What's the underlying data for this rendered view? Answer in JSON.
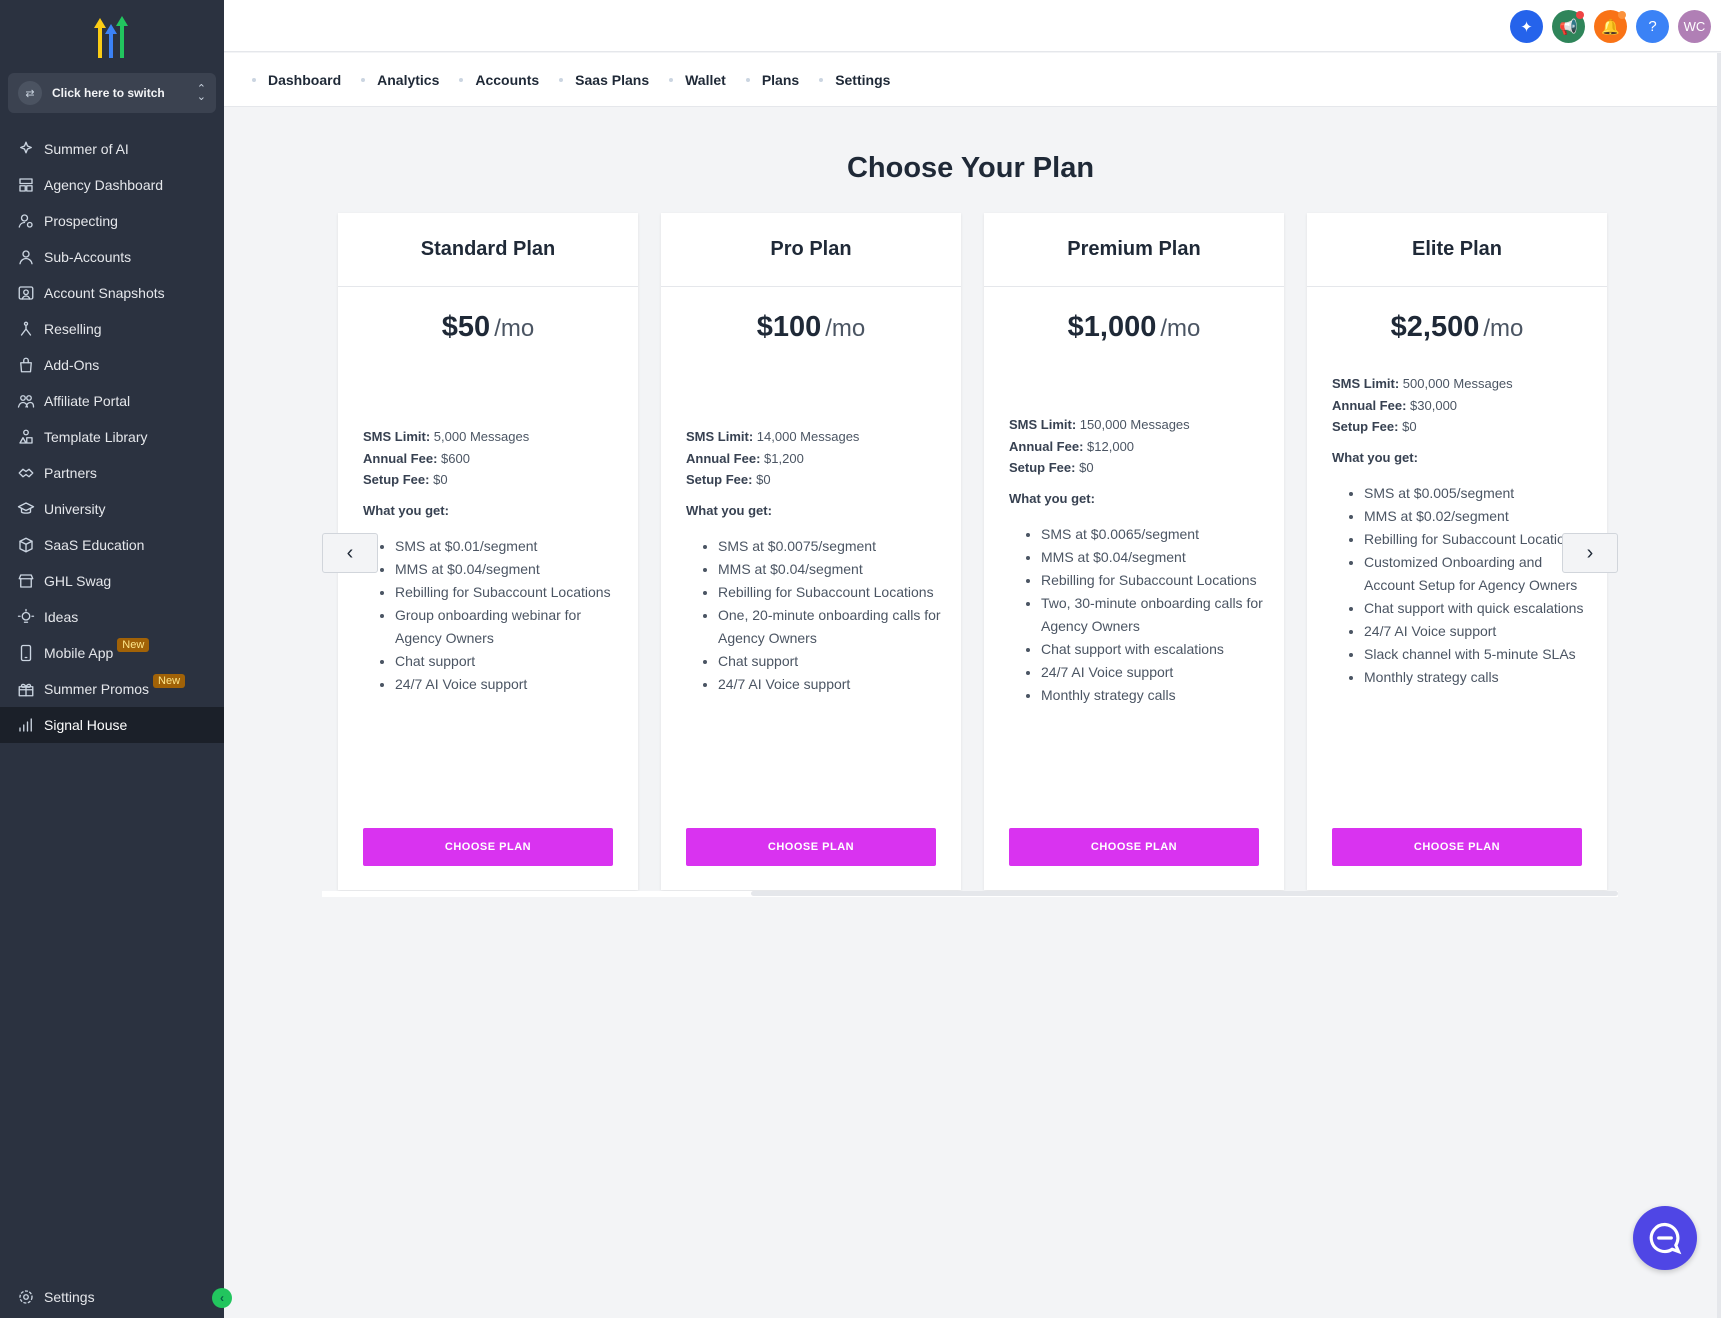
{
  "sidebar": {
    "switcher_label": "Click here to switch",
    "items": [
      {
        "label": "Summer of AI",
        "icon": "sparkle-icon"
      },
      {
        "label": "Agency Dashboard",
        "icon": "dashboard-icon"
      },
      {
        "label": "Prospecting",
        "icon": "prospecting-icon"
      },
      {
        "label": "Sub-Accounts",
        "icon": "user-icon"
      },
      {
        "label": "Account Snapshots",
        "icon": "snapshot-icon"
      },
      {
        "label": "Reselling",
        "icon": "reselling-icon"
      },
      {
        "label": "Add-Ons",
        "icon": "bag-icon"
      },
      {
        "label": "Affiliate Portal",
        "icon": "users-icon"
      },
      {
        "label": "Template Library",
        "icon": "shapes-icon"
      },
      {
        "label": "Partners",
        "icon": "handshake-icon"
      },
      {
        "label": "University",
        "icon": "graduation-cap-icon"
      },
      {
        "label": "SaaS Education",
        "icon": "cube-icon"
      },
      {
        "label": "GHL Swag",
        "icon": "store-icon"
      },
      {
        "label": "Ideas",
        "icon": "lightbulb-icon"
      },
      {
        "label": "Mobile App",
        "icon": "phone-icon",
        "badge": "New"
      },
      {
        "label": "Summer Promos",
        "icon": "gift-icon",
        "badge": "New"
      },
      {
        "label": "Signal House",
        "icon": "signal-icon",
        "active": true
      }
    ],
    "settings_label": "Settings"
  },
  "header": {
    "avatar_initials": "WC",
    "help_glyph": "?"
  },
  "subnav": [
    "Dashboard",
    "Analytics",
    "Accounts",
    "Saas Plans",
    "Wallet",
    "Plans",
    "Settings"
  ],
  "page_title": "Choose Your Plan",
  "labels": {
    "sms_limit": "SMS Limit:",
    "annual_fee": "Annual Fee:",
    "setup_fee": "Setup Fee:",
    "what_you_get": "What you get:",
    "per_month": "/mo",
    "choose": "CHOOSE PLAN"
  },
  "plans": [
    {
      "name": "Standard Plan",
      "price": "$50",
      "sms_limit": "5,000 Messages",
      "annual_fee": "$600",
      "setup_fee": "$0",
      "features": [
        "SMS at $0.01/segment",
        "MMS at $0.04/segment",
        "Rebilling for Subaccount Locations",
        "Group onboarding webinar for Agency Owners",
        "Chat support",
        "24/7 AI Voice support"
      ]
    },
    {
      "name": "Pro Plan",
      "price": "$100",
      "sms_limit": "14,000 Messages",
      "annual_fee": "$1,200",
      "setup_fee": "$0",
      "features": [
        "SMS at $0.0075/segment",
        "MMS at $0.04/segment",
        "Rebilling for Subaccount Locations",
        "One, 20-minute onboarding calls for Agency Owners",
        "Chat support",
        "24/7 AI Voice support"
      ]
    },
    {
      "name": "Premium Plan",
      "price": "$1,000",
      "sms_limit": "150,000 Messages",
      "annual_fee": "$12,000",
      "setup_fee": "$0",
      "features": [
        "SMS at $0.0065/segment",
        "MMS at $0.04/segment",
        "Rebilling for Subaccount Locations",
        "Two, 30-minute onboarding calls for Agency Owners",
        "Chat support with escalations",
        "24/7 AI Voice support",
        "Monthly strategy calls"
      ]
    },
    {
      "name": "Elite Plan",
      "price": "$2,500",
      "sms_limit": "500,000 Messages",
      "annual_fee": "$30,000",
      "setup_fee": "$0",
      "features": [
        "SMS at $0.005/segment",
        "MMS at $0.02/segment",
        "Rebilling for Subaccount Locations",
        "Customized Onboarding and Account Setup for Agency Owners",
        "Chat support with quick escalations",
        "24/7 AI Voice support",
        "Slack channel with 5-minute SLAs",
        "Monthly strategy calls"
      ]
    }
  ],
  "colors": {
    "sidebar_bg": "#2b3240",
    "accent_button": "#d933f0",
    "chat_fab": "#4f46e5"
  }
}
